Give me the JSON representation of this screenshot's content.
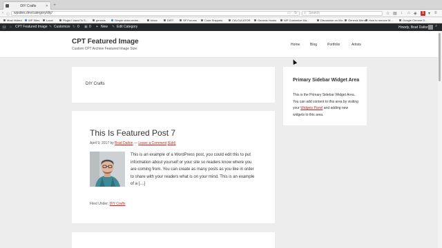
{
  "browser": {
    "tab_title": "DIY Crafts",
    "url": "wpsites.dev/category/diy/",
    "search_placeholder": "Search"
  },
  "bookmarks": [
    {
      "label": "Most Visited",
      "color": "#6a6a6a"
    },
    {
      "label": "WP Sites",
      "color": "#5a7fb8"
    },
    {
      "label": "Local",
      "color": "#6a6a6a"
    },
    {
      "label": "Plugin I Used To S...",
      "color": "#6a6a6a"
    },
    {
      "label": "genesis",
      "color": "#6a6a6a"
    },
    {
      "label": "Simple video embe...",
      "color": "#3b8ed8"
    },
    {
      "label": "Inbox",
      "color": "#6a6a6a"
    },
    {
      "label": "DIRT",
      "color": "#6a6a6a"
    },
    {
      "label": "SP Forums",
      "color": "#6a6a6a"
    },
    {
      "label": "Code Snippets",
      "color": "#6a6a6a"
    },
    {
      "label": "CALCULATOR",
      "color": "#6a6a6a"
    },
    {
      "label": "Genesis Hooks",
      "color": "#6a6a6a"
    },
    {
      "label": "WP Customize Ma...",
      "color": "#6a6a6a"
    },
    {
      "label": "Discussion on Wo...",
      "color": "#6a6a6a"
    },
    {
      "label": "Genesis Menus",
      "color": "#6a6a6a"
    },
    {
      "label": "How to remove M...",
      "color": "#6a6a6a"
    },
    {
      "label": "Google Chrome D...",
      "color": "#6a6a6a"
    }
  ],
  "adminbar": {
    "site_name": "CPT Featured Image",
    "customize": "Customize",
    "updates": "0",
    "comments": "0",
    "new": "New",
    "edit": "Edit Category",
    "howdy": "Howdy, Brad Dalton"
  },
  "site": {
    "title": "CPT Featured Image",
    "description": "Custom CPT Archive Featured Image Size",
    "menu": [
      "Home",
      "Blog",
      "Portfolio",
      "Artists"
    ]
  },
  "archive": {
    "title": "DIY Crafts"
  },
  "post": {
    "title": "This Is Featured Post 7",
    "date": "April 9, 2017 by",
    "author": "Brad Dalton",
    "separator": "—",
    "comment_link": "Leave a Comment",
    "edit_link": "(Edit)",
    "excerpt": "This is an example of a WordPress post, you could edit this to put information about yourself or your site so readers know where you are coming from. You can create as many posts as you like in order to share with your readers what is on your mind. This is an example of a […]",
    "filed_under_label": "Filed Under:",
    "category": "DIY Crafts"
  },
  "sidebar": {
    "widget_title": "Primary Sidebar Widget Area",
    "widget_text_before": "This is the Primary Sidebar Widget Area. You can add content to this area by visiting your",
    "widget_link": "Widgets Panel",
    "widget_text_after": "and adding new widgets to this area."
  },
  "colors": {
    "accent_link": "#c3251d",
    "adminbar_bg": "#23282d"
  }
}
